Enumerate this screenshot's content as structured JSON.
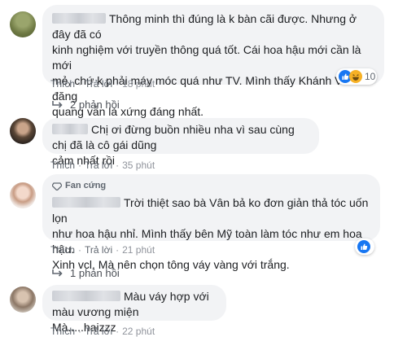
{
  "comments": [
    {
      "text_lines": [
        "Thông minh thì đúng là k bàn cãi được. Nhưng ở đây đã có",
        "kinh nghiệm với truyền thông quá tốt. Cái hoa hậu mới cần là mới",
        "mẻ, chứ k phải máy móc quá như TV. Mình thấy Khánh Vân đăng",
        "quang vẫn là xứng đáng nhất."
      ],
      "like": "Thích",
      "reply": "Trả lời",
      "time": "18 phút",
      "reaction_count": "10",
      "reactions": [
        "like-icon",
        "haha-icon"
      ],
      "replies": "2 phản hồi"
    },
    {
      "text_lines": [
        "Chị ơi đừng buồn nhiều nha vì sau cùng chị đã là cô gái dũng",
        "cảm nhất rồi"
      ],
      "like": "Thích",
      "reply": "Trả lời",
      "time": "35 phút"
    },
    {
      "badge": "Fan cứng",
      "text_lines": [
        "Trời thiệt sao bà Vân bả ko đơn giản thả tóc uốn lọn",
        "như hoa hậu nhỉ. Mình thấy bên Mỹ toàn làm tóc như em hoa hậu.",
        "Xinh vcl. Mà nên chọn tông váy vàng với trắng."
      ],
      "like": "Thích",
      "reply": "Trả lời",
      "time": "21 phút",
      "reactions": [
        "like-icon"
      ],
      "replies": "1 phản hồi"
    },
    {
      "text_lines": [
        "Màu váy hợp với màu vương miện",
        "Mà.....haizzz"
      ],
      "like": "Thích",
      "reply": "Trả lời",
      "time": "22 phút"
    }
  ]
}
